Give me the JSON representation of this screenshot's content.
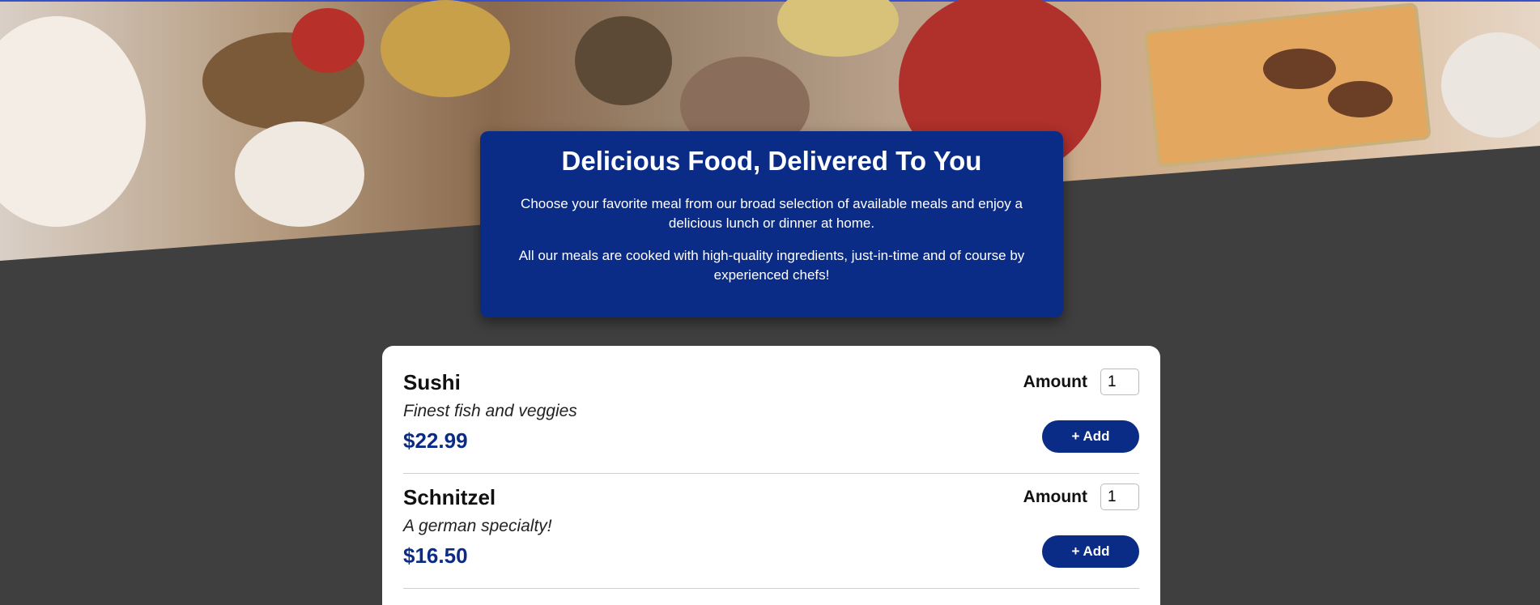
{
  "intro": {
    "title": "Delicious Food, Delivered To You",
    "paragraph1": "Choose your favorite meal from our broad selection of available meals and enjoy a delicious lunch or dinner at home.",
    "paragraph2": "All our meals are cooked with high-quality ingredients, just-in-time and of course by experienced chefs!"
  },
  "meals": [
    {
      "name": "Sushi",
      "description": "Finest fish and veggies",
      "price": "$22.99",
      "amount_label": "Amount",
      "amount_value": "1",
      "add_label": "+ Add"
    },
    {
      "name": "Schnitzel",
      "description": "A german specialty!",
      "price": "$16.50",
      "amount_label": "Amount",
      "amount_value": "1",
      "add_label": "+ Add"
    }
  ],
  "colors": {
    "primary": "#0a2c86",
    "background": "#3f3f3f"
  }
}
